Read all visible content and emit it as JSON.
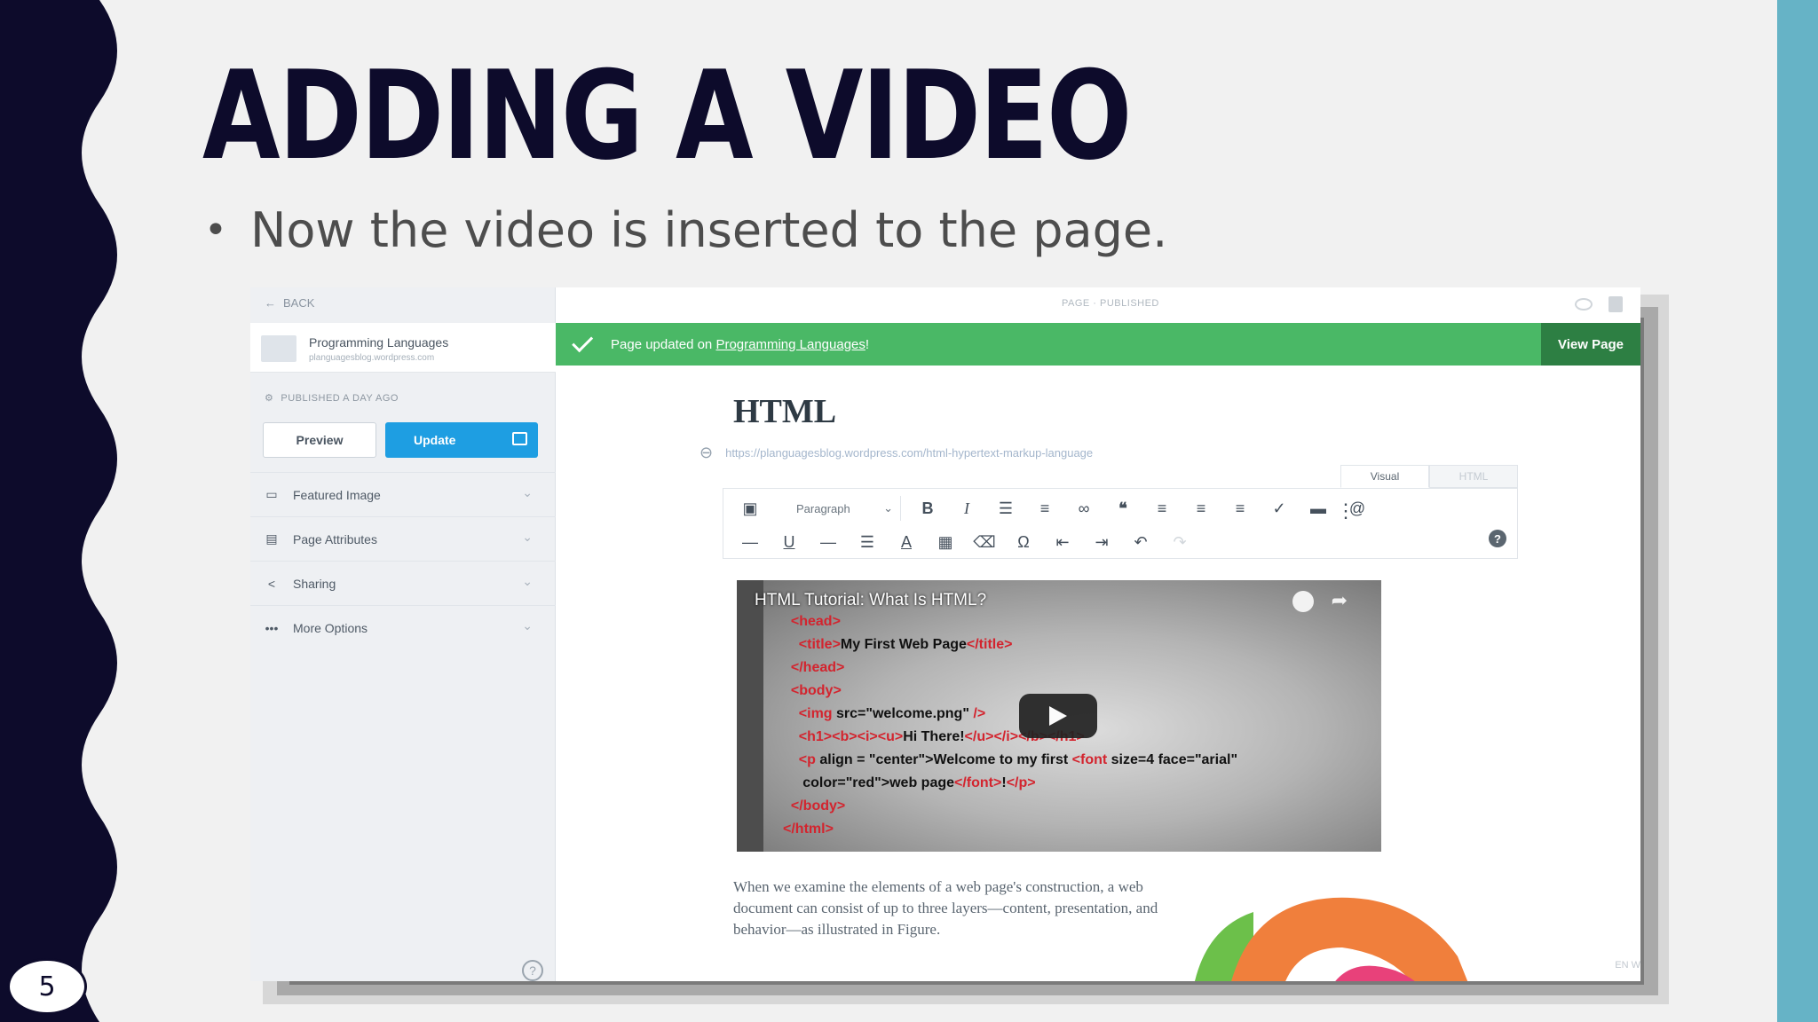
{
  "slide": {
    "title": "ADDING A VIDEO",
    "bullet": "Now the video is inserted to the page.",
    "page_number": "5",
    "colors": {
      "navy": "#0d0b2b",
      "teal": "#66b3c6",
      "text": "#4d4d4d"
    }
  },
  "editor": {
    "back_label": "BACK",
    "site_name": "Programming Languages",
    "site_url": "planguagesblog.wordpress.com",
    "status": "PUBLISHED A DAY AGO",
    "preview_label": "Preview",
    "update_label": "Update",
    "sidebar_items": [
      {
        "label": "Featured Image",
        "icon": "image-icon"
      },
      {
        "label": "Page Attributes",
        "icon": "page-icon"
      },
      {
        "label": "Sharing",
        "icon": "share-icon"
      },
      {
        "label": "More Options",
        "icon": "ellipsis-icon"
      }
    ],
    "top_status": "PAGE · PUBLISHED",
    "notice_prefix": "Page updated on ",
    "notice_link": "Programming Languages",
    "notice_suffix": "!",
    "view_page_label": "View Page",
    "doc_title": "HTML",
    "permalink": "https://planguagesblog.wordpress.com/html-hypertext-markup-language",
    "tabs": {
      "visual": "Visual",
      "html": "HTML"
    },
    "format_select": "Paragraph",
    "video": {
      "title": "HTML Tutorial: What Is HTML?",
      "code_lines": [
        {
          "indent": "  ",
          "parts": [
            [
              "tag",
              "<head>"
            ]
          ]
        },
        {
          "indent": "    ",
          "parts": [
            [
              "tag",
              "<title>"
            ],
            [
              "txt",
              "My First Web Page"
            ],
            [
              "tag",
              "</title>"
            ]
          ]
        },
        {
          "indent": "  ",
          "parts": [
            [
              "tag",
              "</head>"
            ]
          ]
        },
        {
          "indent": "  ",
          "parts": [
            [
              "tag",
              "<body>"
            ]
          ]
        },
        {
          "indent": "    ",
          "parts": [
            [
              "tag",
              "<img"
            ],
            [
              "txt",
              " src=\"welcome.png\""
            ],
            [
              "tag",
              " />"
            ]
          ]
        },
        {
          "indent": "    ",
          "parts": [
            [
              "tag",
              "<h1><b><i><u>"
            ],
            [
              "txt",
              "Hi There!"
            ],
            [
              "tag",
              "</u></i></b></h1>"
            ]
          ]
        },
        {
          "indent": "    ",
          "parts": [
            [
              "tag",
              "<p"
            ],
            [
              "txt",
              " align = \"center\">Welcome to my first "
            ],
            [
              "tag",
              "<font"
            ],
            [
              "txt",
              " size=4 face=\"arial\""
            ]
          ]
        },
        {
          "indent": "     ",
          "parts": [
            [
              "txt",
              "color=\"red\">web page"
            ],
            [
              "tag",
              "</font>"
            ],
            [
              "txt",
              "!"
            ],
            [
              "tag",
              "</p>"
            ]
          ]
        },
        {
          "indent": "  ",
          "parts": [
            [
              "tag",
              "</body>"
            ]
          ]
        },
        {
          "indent": "",
          "parts": [
            [
              "tag",
              "</html>"
            ]
          ]
        }
      ]
    },
    "paragraph": "When we examine the elements of a web page's construction, a web document can consist of up to three layers—content, presentation, and behavior—as illustrated in Figure.",
    "lang_hint": "EN W"
  }
}
